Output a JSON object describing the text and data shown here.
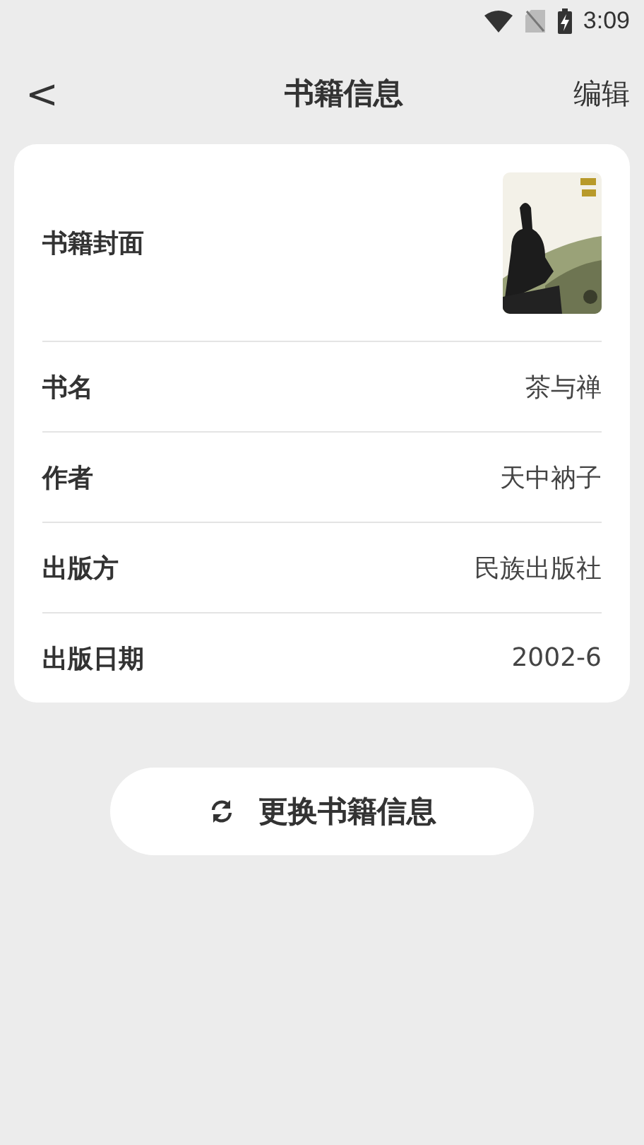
{
  "status_bar": {
    "time": "3:09"
  },
  "header": {
    "back": "<",
    "title": "书籍信息",
    "action": "编辑"
  },
  "rows": [
    {
      "label": "书籍封面"
    },
    {
      "kind": "text",
      "label": "书名",
      "value": "茶与禅"
    },
    {
      "kind": "text",
      "label": "作者",
      "value": "天中衲子"
    },
    {
      "kind": "text",
      "label": "出版方",
      "value": "民族出版社"
    },
    {
      "kind": "text",
      "label": "出版日期",
      "value": "2002-6"
    }
  ],
  "button": {
    "label": "更换书籍信息"
  }
}
